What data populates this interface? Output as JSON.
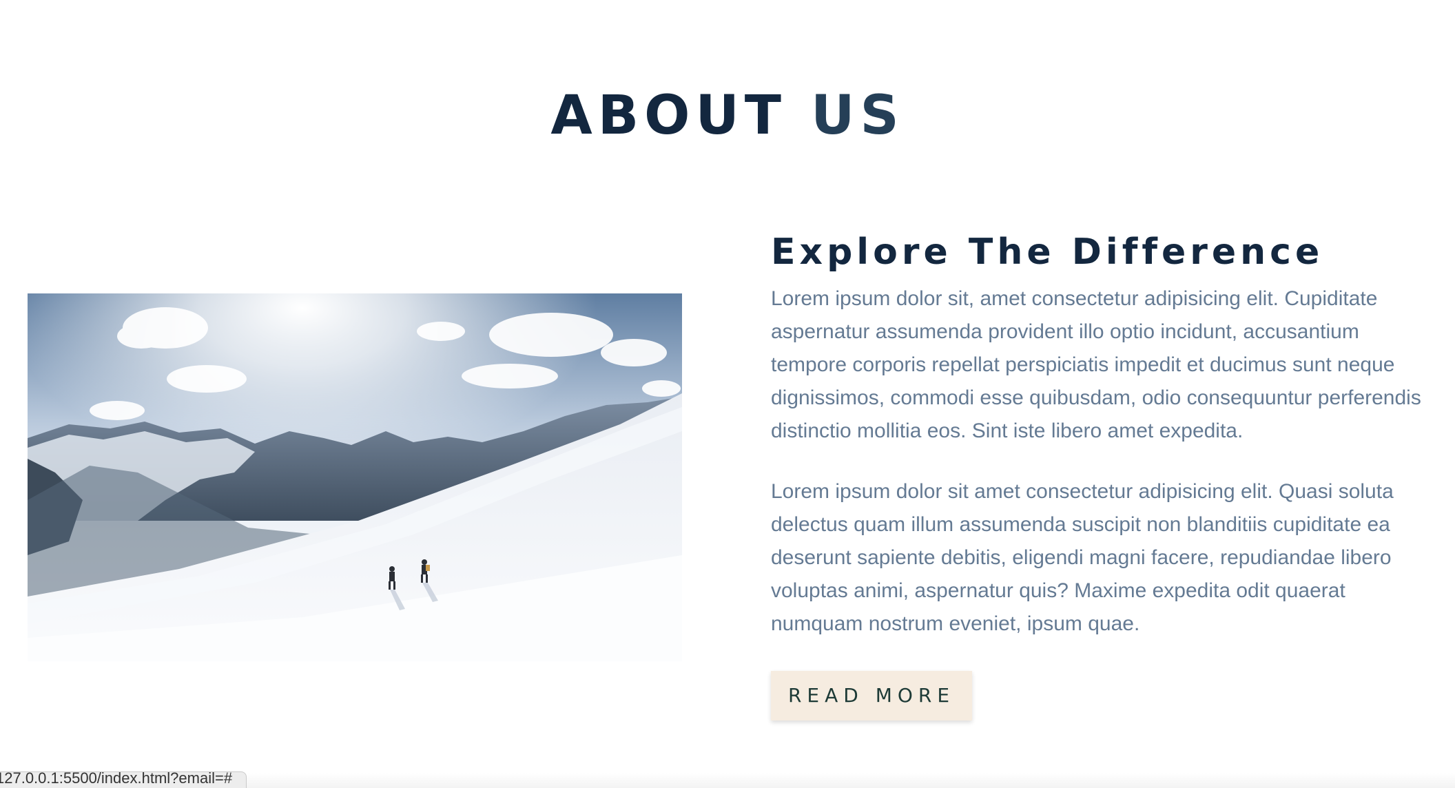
{
  "about": {
    "title_main": "ABOUT ",
    "title_accent": "US"
  },
  "content": {
    "subtitle": "Explore The Difference",
    "paragraphs": [
      "Lorem ipsum dolor sit, amet consectetur adipisicing elit. Cupiditate aspernatur assumenda provident illo optio incidunt, accusantium tempore corporis repellat perspiciatis impedit et ducimus sunt neque dignissimos, commodi esse quibusdam, odio consequuntur perferendis distinctio mollitia eos. Sint iste libero amet expedita.",
      "Lorem ipsum dolor sit amet consectetur adipisicing elit. Quasi soluta delectus quam illum assumenda suscipit non blanditiis cupiditate ea deserunt sapiente debitis, eligendi magni facere, repudiandae libero voluptas animi, aspernatur quis? Maxime expedita odit quaerat numquam nostrum eveniet, ipsum quae."
    ],
    "button_label": "READ MORE"
  },
  "image": {
    "icon": "snowy-mountain-hikers-photo"
  },
  "status_bar": {
    "url": "127.0.0.1:5500/index.html?email=#"
  },
  "colors": {
    "heading": "#13273f",
    "heading_accent": "#253f57",
    "body_text": "#647a93",
    "button_bg": "#f6ece0",
    "button_text": "#1d3a36"
  }
}
